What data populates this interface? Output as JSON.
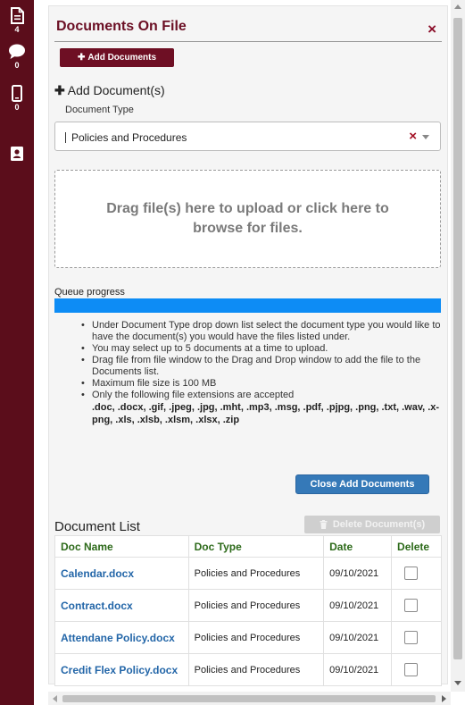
{
  "rail": {
    "items": [
      {
        "icon": "document-icon",
        "count": "4"
      },
      {
        "icon": "chat-bubble-icon",
        "count": "0"
      },
      {
        "icon": "mobile-phone-icon",
        "count": "0"
      },
      {
        "icon": "contact-card-icon",
        "count": ""
      }
    ]
  },
  "panel": {
    "title": "Documents On File",
    "close_label": "×",
    "add_button_label": "Add Documents",
    "section_heading": "Add Document(s)",
    "document_type_label": "Document Type",
    "document_type_value": "Policies and Procedures",
    "clear_label": "×",
    "dropzone_text": "Drag file(s) here to upload or click here to browse for files.",
    "queue_label": "Queue progress",
    "queue_progress": 1.0,
    "instructions": [
      "Under Document Type drop down list select the document type you would like to have the document(s) you would have the files listed under.",
      "You may select up to 5 documents at a time to upload.",
      "Drag file from file window to the Drag and Drop window to add the file to the Documents list.",
      "Maximum file size is 100 MB",
      "Only the following file extensions are accepted"
    ],
    "extensions": ".doc, .docx, .gif, .jpeg, .jpg, .mht, .mp3, .msg, .pdf, .pjpg, .png, .txt, .wav, .x-png, .xls, .xlsb, .xlsm, .xlsx, .zip",
    "close_add_button_label": "Close Add Documents",
    "document_list_title": "Document List",
    "delete_button_label": "Delete Document(s)"
  },
  "table": {
    "headers": [
      "Doc Name",
      "Doc Type",
      "Date",
      "Delete"
    ],
    "rows": [
      {
        "name": "Calendar.docx",
        "type": "Policies and Procedures",
        "date": "09/10/2021"
      },
      {
        "name": "Contract.docx",
        "type": "Policies and Procedures",
        "date": "09/10/2021"
      },
      {
        "name": "Attendane Policy.docx",
        "type": "Policies and Procedures",
        "date": "09/10/2021"
      },
      {
        "name": "Credit Flex Policy.docx",
        "type": "Policies and Procedures",
        "date": "09/10/2021"
      }
    ]
  },
  "colors": {
    "rail": "#5b0d1b",
    "brand": "#6e0f24",
    "progress": "#0d8cf5",
    "button_blue": "#3579b8",
    "header_green": "#2d6a1a",
    "link_blue": "#2366a8"
  }
}
